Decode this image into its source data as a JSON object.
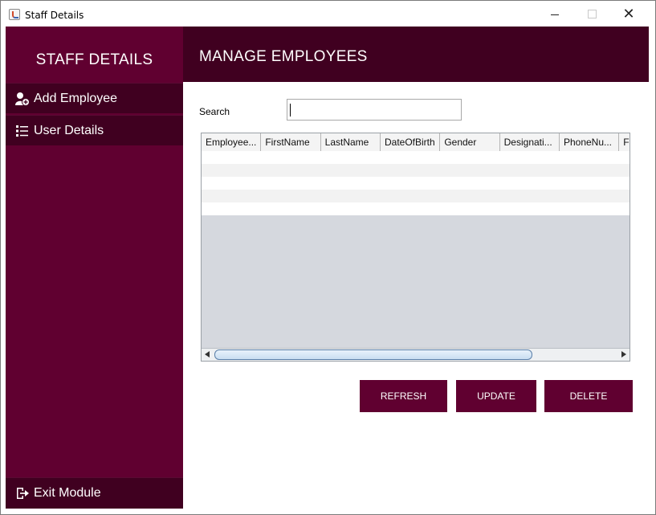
{
  "window": {
    "title": "Staff Details"
  },
  "sidebar": {
    "title": "STAFF DETAILS",
    "items": [
      {
        "label": "Add Employee",
        "icon": "add-user-icon"
      },
      {
        "label": "User Details",
        "icon": "list-icon"
      }
    ],
    "exit_label": "Exit Module",
    "exit_icon": "exit-icon"
  },
  "header": {
    "title": "MANAGE EMPLOYEES"
  },
  "search": {
    "label": "Search",
    "value": ""
  },
  "table": {
    "columns": [
      "Employee...",
      "FirstName",
      "LastName",
      "DateOfBirth",
      "Gender",
      "Designati...",
      "PhoneNu...",
      "F"
    ],
    "rows": []
  },
  "buttons": {
    "refresh": "REFRESH",
    "update": "UPDATE",
    "delete": "DELETE"
  },
  "colors": {
    "primary": "#600030",
    "dark": "#400020",
    "table_bg": "#d5d8de"
  }
}
